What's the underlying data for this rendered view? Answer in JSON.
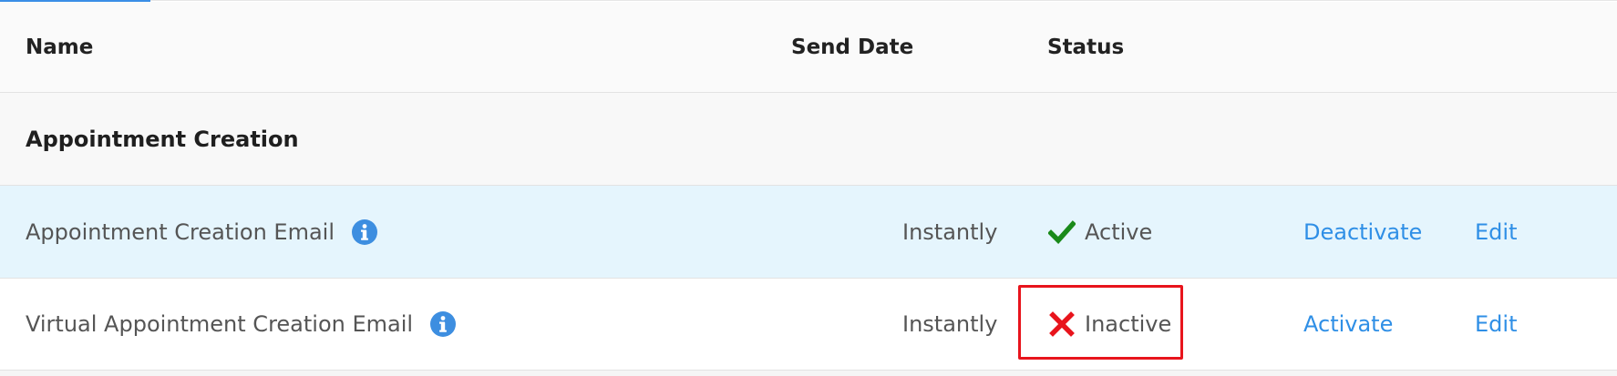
{
  "header": {
    "name_col": "Name",
    "send_date_col": "Send Date",
    "status_col": "Status"
  },
  "group": {
    "title": "Appointment Creation"
  },
  "rows": [
    {
      "name": "Appointment Creation Email",
      "send_date": "Instantly",
      "status": "Active",
      "status_icon": "check-icon",
      "toggle_action": "Deactivate",
      "edit_action": "Edit"
    },
    {
      "name": "Virtual Appointment Creation Email",
      "send_date": "Instantly",
      "status": "Inactive",
      "status_icon": "x-icon",
      "toggle_action": "Activate",
      "edit_action": "Edit"
    }
  ],
  "colors": {
    "active_check": "#1a8a1a",
    "inactive_x": "#e8141c",
    "link": "#2f8fe6",
    "info_icon": "#3d8ee0",
    "selected_row": "#e5f5fd",
    "highlight_border": "#e8141c"
  }
}
